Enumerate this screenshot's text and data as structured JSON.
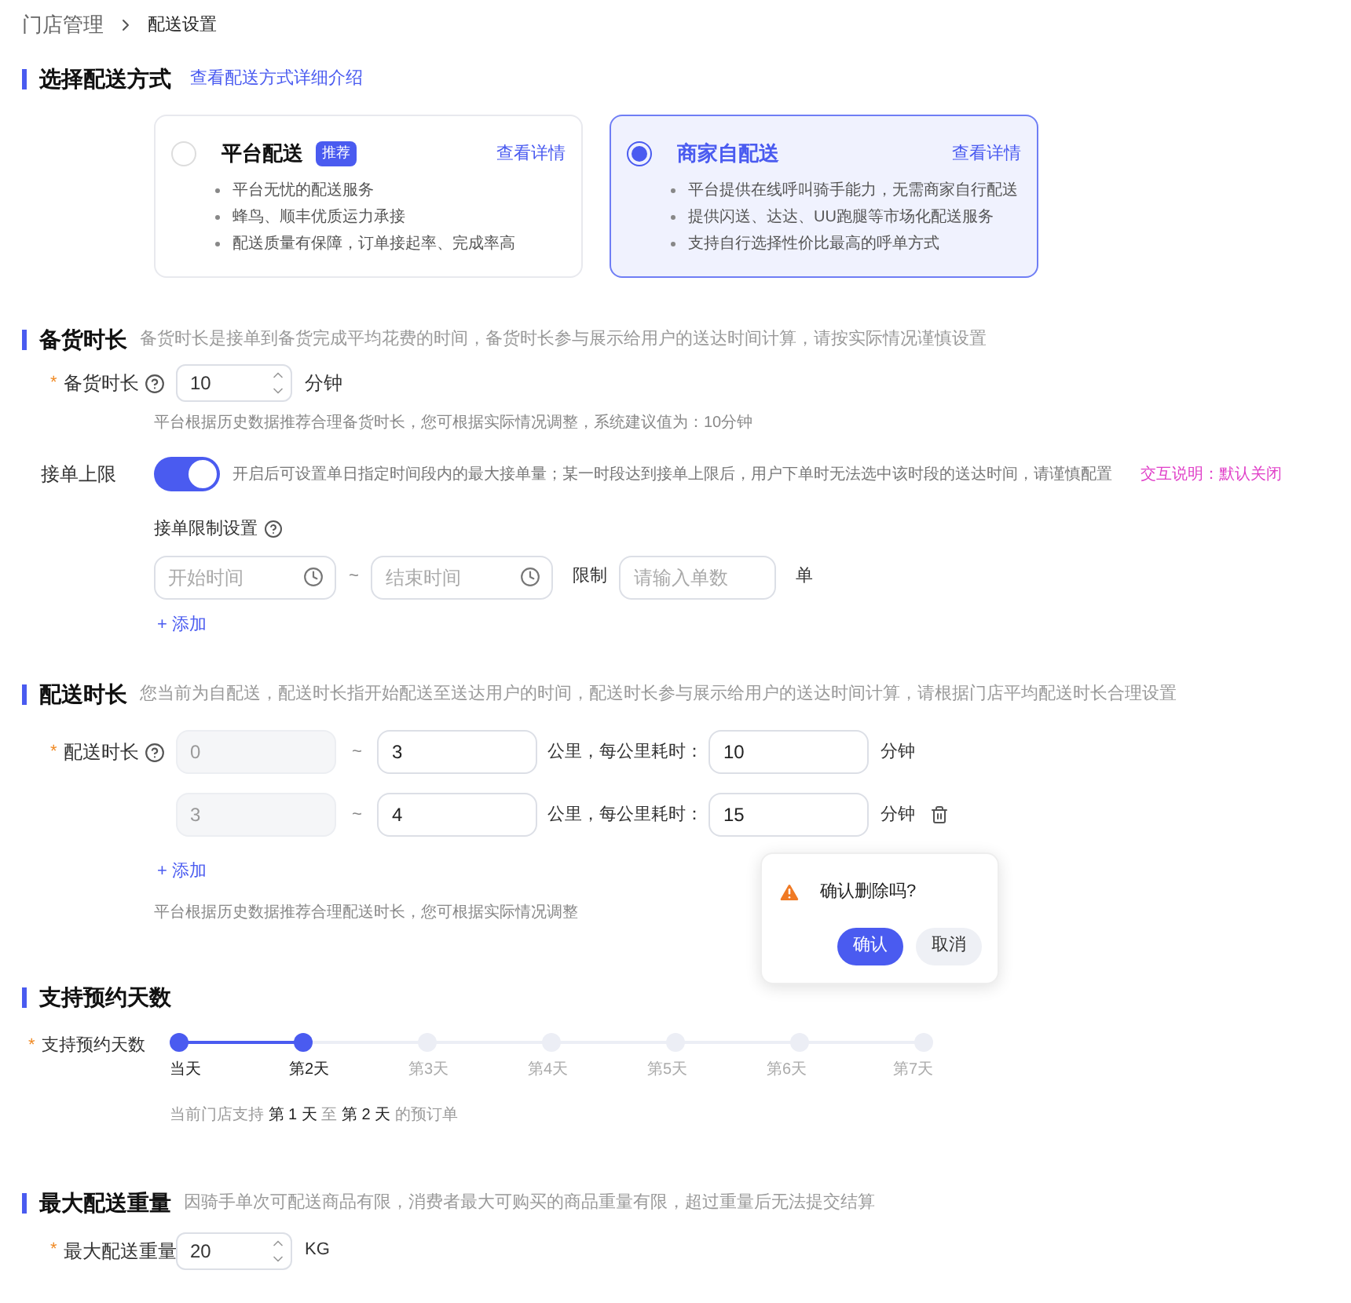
{
  "breadcrumb": [
    "门店管理",
    "配送设置"
  ],
  "delivery_method": {
    "title": "选择配送方式",
    "link": "查看配送方式详细介绍",
    "options": [
      {
        "name": "平台配送",
        "badge": "推荐",
        "link": "查看详情",
        "selected": false,
        "points": [
          "平台无忧的配送服务",
          "蜂鸟、顺丰优质运力承接",
          "配送质量有保障，订单接起率、完成率高"
        ]
      },
      {
        "name": "商家自配送",
        "link": "查看详情",
        "selected": true,
        "points": [
          "平台提供在线呼叫骑手能力，无需商家自行配送",
          "提供闪送、达达、UU跑腿等市场化配送服务",
          "支持自行选择性价比最高的呼单方式"
        ]
      }
    ]
  },
  "prep_time": {
    "title": "备货时长",
    "desc": "备货时长是接单到备货完成平均花费的时间，备货时长参与展示给用户的送达时间计算，请按实际情况谨慎设置",
    "required_mark": "*",
    "label": "备货时长",
    "value": "10",
    "unit": "分钟",
    "hint": "平台根据历史数据推荐合理备货时长，您可根据实际情况调整，系统建议值为：10分钟",
    "limit_label": "接单上限",
    "limit_on": true,
    "limit_desc": "开启后可设置单日指定时间段内的最大接单量；某一时段达到接单上限后，用户下单时无法选中该时段的送达时间，请谨慎配置",
    "note": "交互说明：默认关闭",
    "limit_settings": "接单限制设置",
    "start_placeholder": "开始时间",
    "tilde": "~",
    "end_placeholder": "结束时间",
    "limit_word": "限制",
    "count_placeholder": "请输入单数",
    "count_unit": "单",
    "add": "+ 添加"
  },
  "delivery_time": {
    "title": "配送时长",
    "desc": "您当前为自配送，配送时长指开始配送至送达用户的时间，配送时长参与展示给用户的送达时间计算，请根据门店平均配送时长合理设置",
    "required_mark": "*",
    "label": "配送时长",
    "rows": [
      {
        "from": "0",
        "tilde": "~",
        "to": "3",
        "mid": "公里，每公里耗时：",
        "minutes": "10",
        "unit": "分钟"
      },
      {
        "from": "3",
        "tilde": "~",
        "to": "4",
        "mid": "公里，每公里耗时：",
        "minutes": "15",
        "unit": "分钟"
      }
    ],
    "add": "+ 添加",
    "hint": "平台根据历史数据推荐合理配送时长，您可根据实际情况调整",
    "popover": {
      "text": "确认删除吗?",
      "confirm": "确认",
      "cancel": "取消"
    }
  },
  "booking": {
    "title": "支持预约天数",
    "required_mark": "*",
    "label": "支持预约天数",
    "days": [
      {
        "label": "当天",
        "selected": true
      },
      {
        "label": "第2天",
        "selected": true
      },
      {
        "label": "第3天",
        "selected": false
      },
      {
        "label": "第4天",
        "selected": false
      },
      {
        "label": "第5天",
        "selected": false
      },
      {
        "label": "第6天",
        "selected": false
      },
      {
        "label": "第7天",
        "selected": false
      }
    ],
    "summary": "当前门店支持 **第 1 天** 至 **第 2 天** 的预订单"
  },
  "max_weight": {
    "title": "最大配送重量",
    "desc": "因骑手单次可配送商品有限，消费者最大可购买的商品重量有限，超过重量后无法提交结算",
    "required_mark": "*",
    "label": "最大配送重量",
    "value": "20",
    "unit": "KG"
  }
}
